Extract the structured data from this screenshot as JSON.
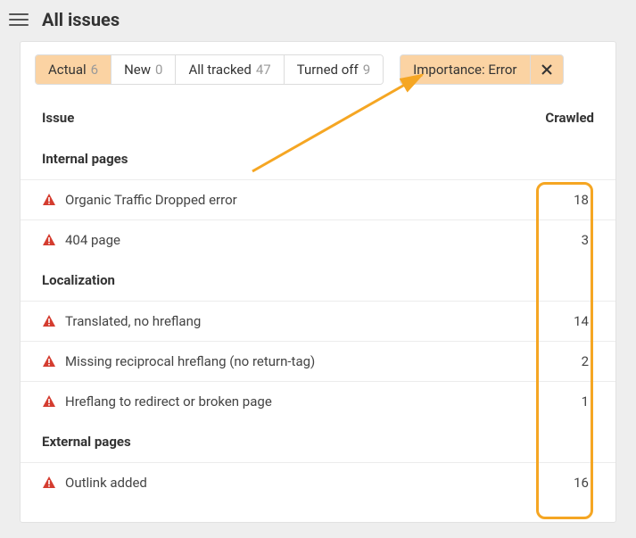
{
  "header": {
    "title": "All issues"
  },
  "filters": {
    "tabs": [
      {
        "label": "Actual",
        "count": "6",
        "active": true
      },
      {
        "label": "New",
        "count": "0",
        "active": false
      },
      {
        "label": "All tracked",
        "count": "47",
        "active": false
      },
      {
        "label": "Turned off",
        "count": "9",
        "active": false
      }
    ],
    "chip": {
      "label": "Importance: Error"
    }
  },
  "columns": {
    "issue": "Issue",
    "crawled": "Crawled"
  },
  "groups": [
    {
      "title": "Internal pages",
      "issues": [
        {
          "name": "Organic Traffic Dropped error",
          "count": "18"
        },
        {
          "name": "404 page",
          "count": "3"
        }
      ]
    },
    {
      "title": "Localization",
      "issues": [
        {
          "name": "Translated, no hreflang",
          "count": "14"
        },
        {
          "name": "Missing reciprocal hreflang (no return-tag)",
          "count": "2"
        },
        {
          "name": "Hreflang to redirect or broken page",
          "count": "1"
        }
      ]
    },
    {
      "title": "External pages",
      "issues": [
        {
          "name": "Outlink added",
          "count": "16"
        }
      ]
    }
  ]
}
